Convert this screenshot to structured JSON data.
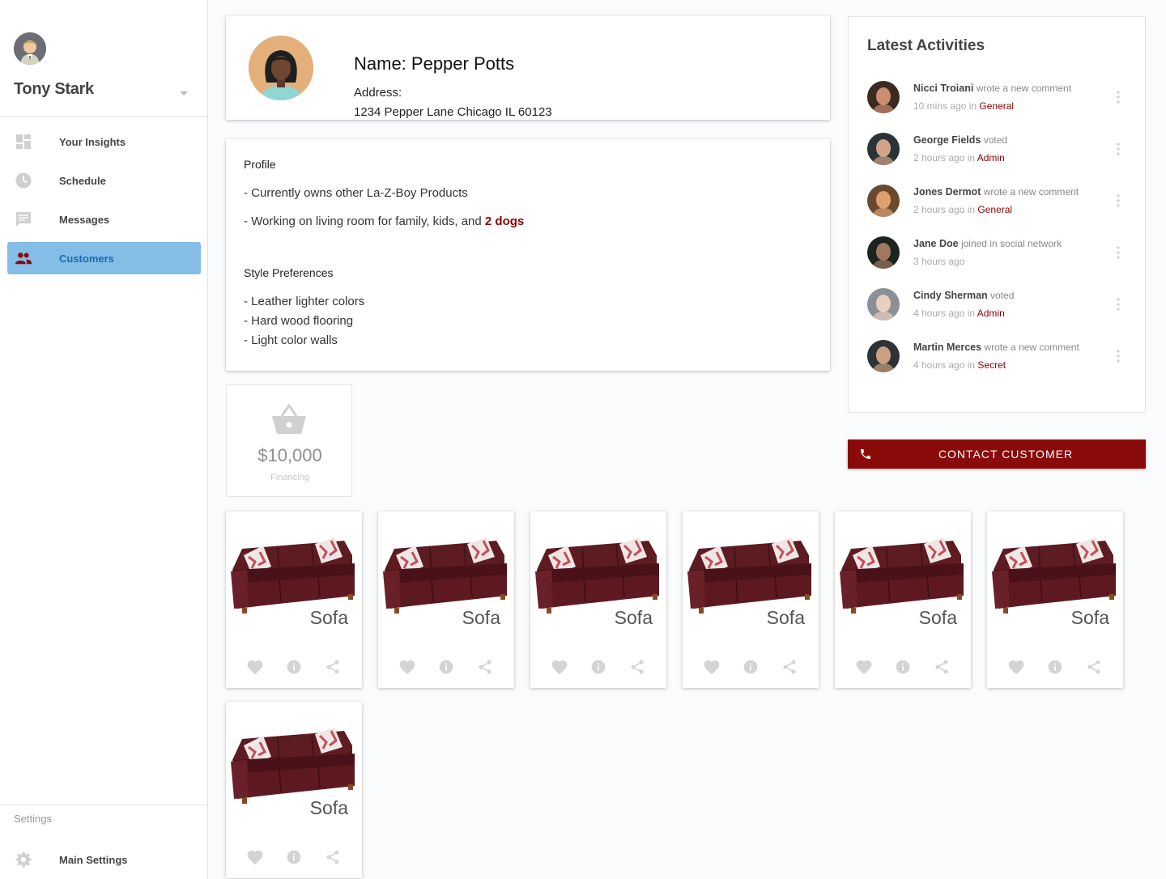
{
  "sidebar": {
    "user_name": "Tony Stark",
    "nav": [
      {
        "label": "Your Insights",
        "icon": "dashboard-icon"
      },
      {
        "label": "Schedule",
        "icon": "clock-icon"
      },
      {
        "label": "Messages",
        "icon": "message-icon"
      },
      {
        "label": "Customers",
        "icon": "people-icon",
        "active": true
      }
    ],
    "settings_section_label": "Settings",
    "main_settings_label": "Main Settings"
  },
  "customer": {
    "name": "Name: Pepper Potts",
    "address_label": "Address:",
    "address": "1234 Pepper Lane Chicago IL 60123"
  },
  "profile": {
    "heading": "Profile",
    "line1": "- Currently owns other La-Z-Boy Products",
    "line2_prefix": "- Working on living room for family, kids, and ",
    "line2_highlight": "2 dogs",
    "style_heading": "Style Preferences",
    "style_items": [
      "- Leather lighter colors",
      "- Hard wood flooring",
      "- Light color walls"
    ]
  },
  "financing": {
    "amount": "$10,000",
    "label": "Financing"
  },
  "activities": {
    "title": "Latest Activities",
    "items": [
      {
        "name": "Nicci Troiani",
        "action": "wrote a new comment",
        "time": "10 mins ago in",
        "tag": "General"
      },
      {
        "name": "George Fields",
        "action": "voted",
        "time": "2 hours ago in",
        "tag": "Admin"
      },
      {
        "name": "Jones Dermot",
        "action": "wrote a new comment",
        "time": "2 hours ago in",
        "tag": "General"
      },
      {
        "name": "Jane Doe",
        "action": "joined in social network",
        "time": "3 hours ago",
        "tag": ""
      },
      {
        "name": "Cindy Sherman",
        "action": "voted",
        "time": "4 hours  ago in",
        "tag": "Admin"
      },
      {
        "name": "Martin Merces",
        "action": "wrote a new comment",
        "time": "4 hours ago in",
        "tag": "Secret"
      }
    ]
  },
  "contact_button_label": "CONTACT CUSTOMER",
  "products": [
    {
      "name": "Sofa"
    },
    {
      "name": "Sofa"
    },
    {
      "name": "Sofa"
    },
    {
      "name": "Sofa"
    },
    {
      "name": "Sofa"
    },
    {
      "name": "Sofa"
    },
    {
      "name": "Sofa"
    }
  ],
  "colors": {
    "accent": "#8a0a0a",
    "active_nav": "#84bde6",
    "sofa": "#5a1a20"
  }
}
